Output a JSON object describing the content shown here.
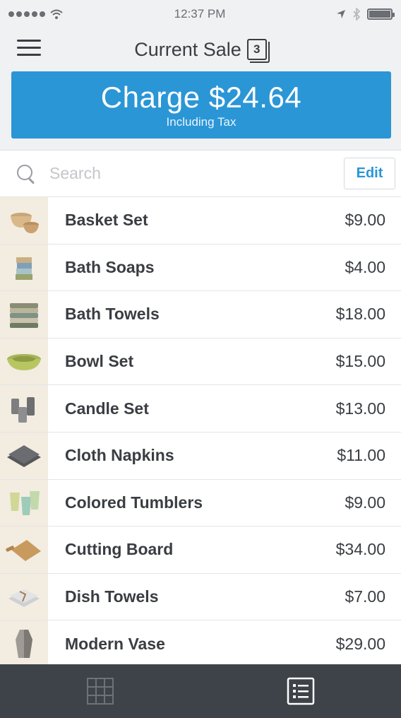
{
  "status_bar": {
    "time": "12:37 PM"
  },
  "header": {
    "title": "Current Sale",
    "ticket_count": "3"
  },
  "charge": {
    "amount": "Charge $24.64",
    "subtitle": "Including Tax"
  },
  "search": {
    "placeholder": "Search",
    "value": "",
    "edit_label": "Edit"
  },
  "items": [
    {
      "name": "Basket Set",
      "price": "$9.00",
      "icon": "basket-set-thumbnail"
    },
    {
      "name": "Bath Soaps",
      "price": "$4.00",
      "icon": "bath-soaps-thumbnail"
    },
    {
      "name": "Bath Towels",
      "price": "$18.00",
      "icon": "bath-towels-thumbnail"
    },
    {
      "name": "Bowl Set",
      "price": "$15.00",
      "icon": "bowl-set-thumbnail"
    },
    {
      "name": "Candle Set",
      "price": "$13.00",
      "icon": "candle-set-thumbnail"
    },
    {
      "name": "Cloth Napkins",
      "price": "$11.00",
      "icon": "cloth-napkins-thumbnail"
    },
    {
      "name": "Colored Tumblers",
      "price": "$9.00",
      "icon": "colored-tumblers-thumbnail"
    },
    {
      "name": "Cutting Board",
      "price": "$34.00",
      "icon": "cutting-board-thumbnail"
    },
    {
      "name": "Dish Towels",
      "price": "$7.00",
      "icon": "dish-towels-thumbnail"
    },
    {
      "name": "Modern Vase",
      "price": "$29.00",
      "icon": "modern-vase-thumbnail"
    }
  ],
  "tabbar": {
    "tabs": [
      {
        "icon": "grid-icon",
        "active": false
      },
      {
        "icon": "list-icon",
        "active": true
      }
    ]
  },
  "colors": {
    "accent": "#2a96d6",
    "tabbar": "#3e4349",
    "text": "#3a3d42"
  }
}
